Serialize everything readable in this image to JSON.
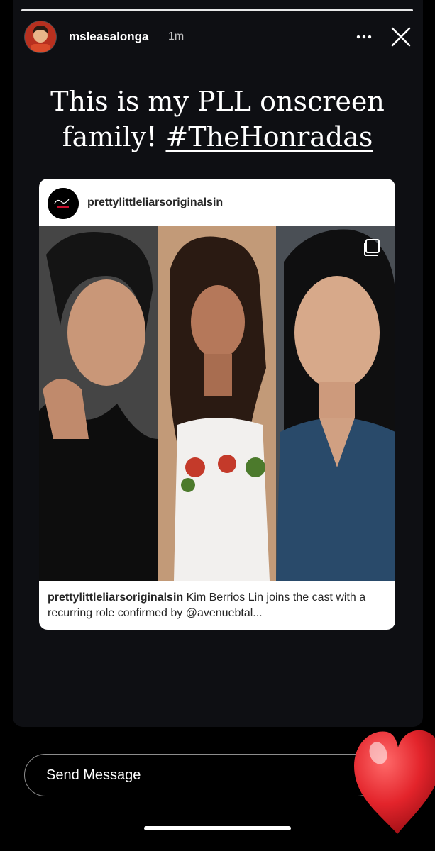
{
  "story": {
    "progress": 1.0,
    "username": "msleasalonga",
    "time_ago": "1m",
    "more_icon": "more-horizontal-icon",
    "close_icon": "close-icon"
  },
  "caption": {
    "text": "This is my PLL onscreen family!",
    "hashtag": "#TheHonradas"
  },
  "shared_post": {
    "username": "prettylittleliarsoriginalsin",
    "body_username": "prettylittleliarsoriginalsin",
    "body_text": " Kim Berrios Lin joins the cast with a recurring role confirmed by @avenuebtal...",
    "multi_icon": "carousel-icon"
  },
  "reply": {
    "placeholder": "Send Message",
    "reaction": "heart-icon"
  },
  "colors": {
    "story_bg": "#0e0f13",
    "heart": "#e3242b",
    "card_bg": "#ffffff"
  }
}
